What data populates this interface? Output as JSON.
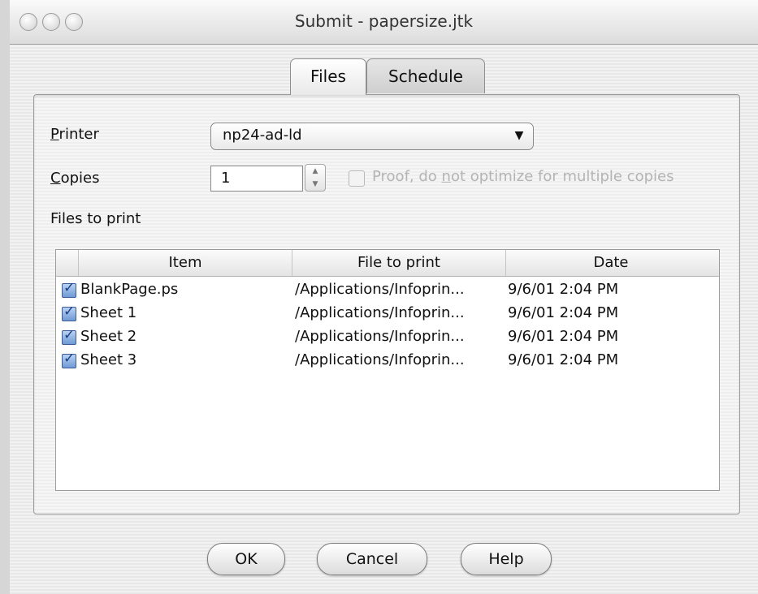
{
  "window": {
    "title": "Submit - papersize.jtk"
  },
  "tabs": [
    {
      "label": "Files",
      "active": true
    },
    {
      "label": "Schedule",
      "active": false
    }
  ],
  "printer": {
    "label_first": "P",
    "label_rest": "rinter",
    "value": "np24-ad-ld",
    "arrow_icon": "triangle-down-icon"
  },
  "copies": {
    "label_first": "C",
    "label_rest": "opies",
    "value": "1",
    "proof_checked": false,
    "proof_label_a": "Proof, do ",
    "proof_label_n": "n",
    "proof_label_b": "ot optimize for multiple copies"
  },
  "files": {
    "label": "Files to print",
    "columns": [
      "Item",
      "File to print",
      "Date"
    ],
    "rows": [
      {
        "checked": true,
        "item": "BlankPage.ps",
        "file": "/Applications/Infoprin...",
        "date": "9/6/01 2:04 PM"
      },
      {
        "checked": true,
        "item": "Sheet 1",
        "file": "/Applications/Infoprin...",
        "date": "9/6/01 2:04 PM"
      },
      {
        "checked": true,
        "item": "Sheet 2",
        "file": "/Applications/Infoprin...",
        "date": "9/6/01 2:04 PM"
      },
      {
        "checked": true,
        "item": "Sheet 3",
        "file": "/Applications/Infoprin...",
        "date": "9/6/01 2:04 PM"
      }
    ]
  },
  "buttons": {
    "ok": "OK",
    "cancel": "Cancel",
    "help": "Help"
  }
}
